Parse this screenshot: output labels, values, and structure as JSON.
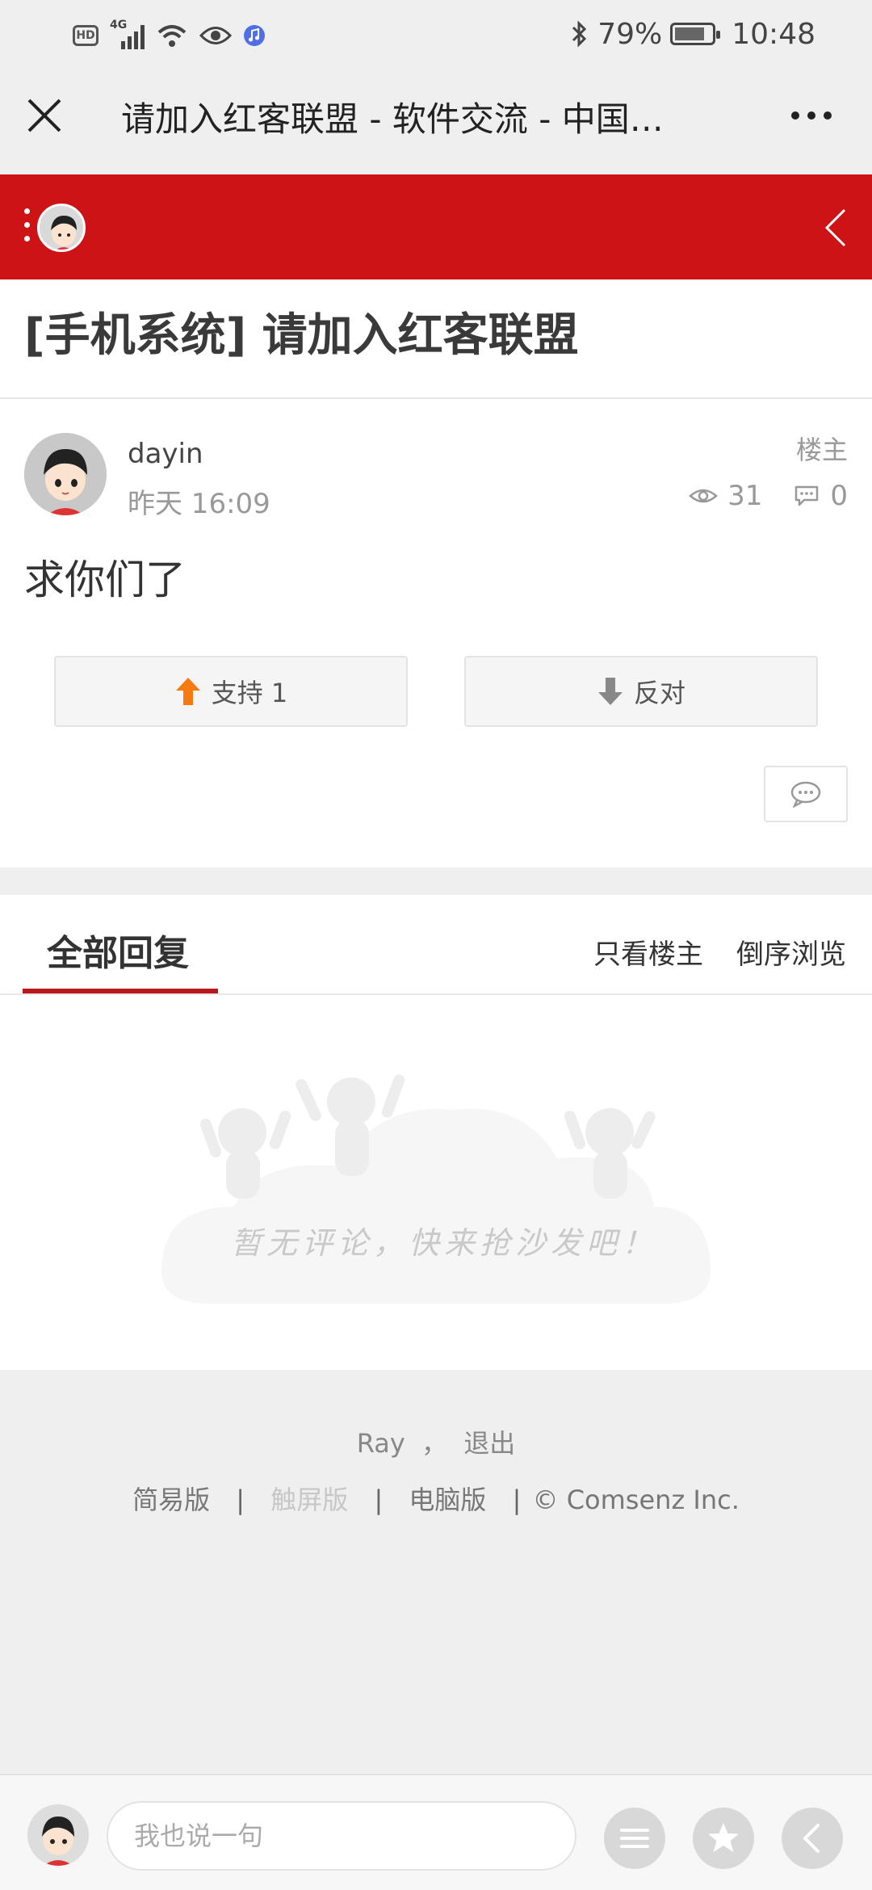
{
  "status_bar": {
    "hd_badge": "HD",
    "network": "4G",
    "battery_percent": "79%",
    "time": "10:48"
  },
  "title_bar": {
    "title": "请加入红客联盟 - 软件交流 - 中国…"
  },
  "post": {
    "title": "[手机系统] 请加入红客联盟",
    "author": "dayin",
    "time": "昨天 16:09",
    "owner_tag": "楼主",
    "views": "31",
    "replies": "0",
    "body": "求你们了",
    "support_label": "支持 1",
    "oppose_label": "反对"
  },
  "replies_section": {
    "tab_all": "全部回复",
    "tab_owner_only": "只看楼主",
    "tab_reverse": "倒序浏览",
    "empty_message": "暂无评论，快来抢沙发吧！"
  },
  "footer": {
    "user": "Ray",
    "comma": "，",
    "logout": "退出",
    "simple": "简易版",
    "touch": "触屏版",
    "pc": "电脑版",
    "copyright": "© Comsenz Inc."
  },
  "bottom_bar": {
    "input_placeholder": "我也说一句"
  },
  "colors": {
    "accent_red": "#cd1316",
    "tab_underline": "#b8191c",
    "support_arrow": "#f57a12"
  }
}
